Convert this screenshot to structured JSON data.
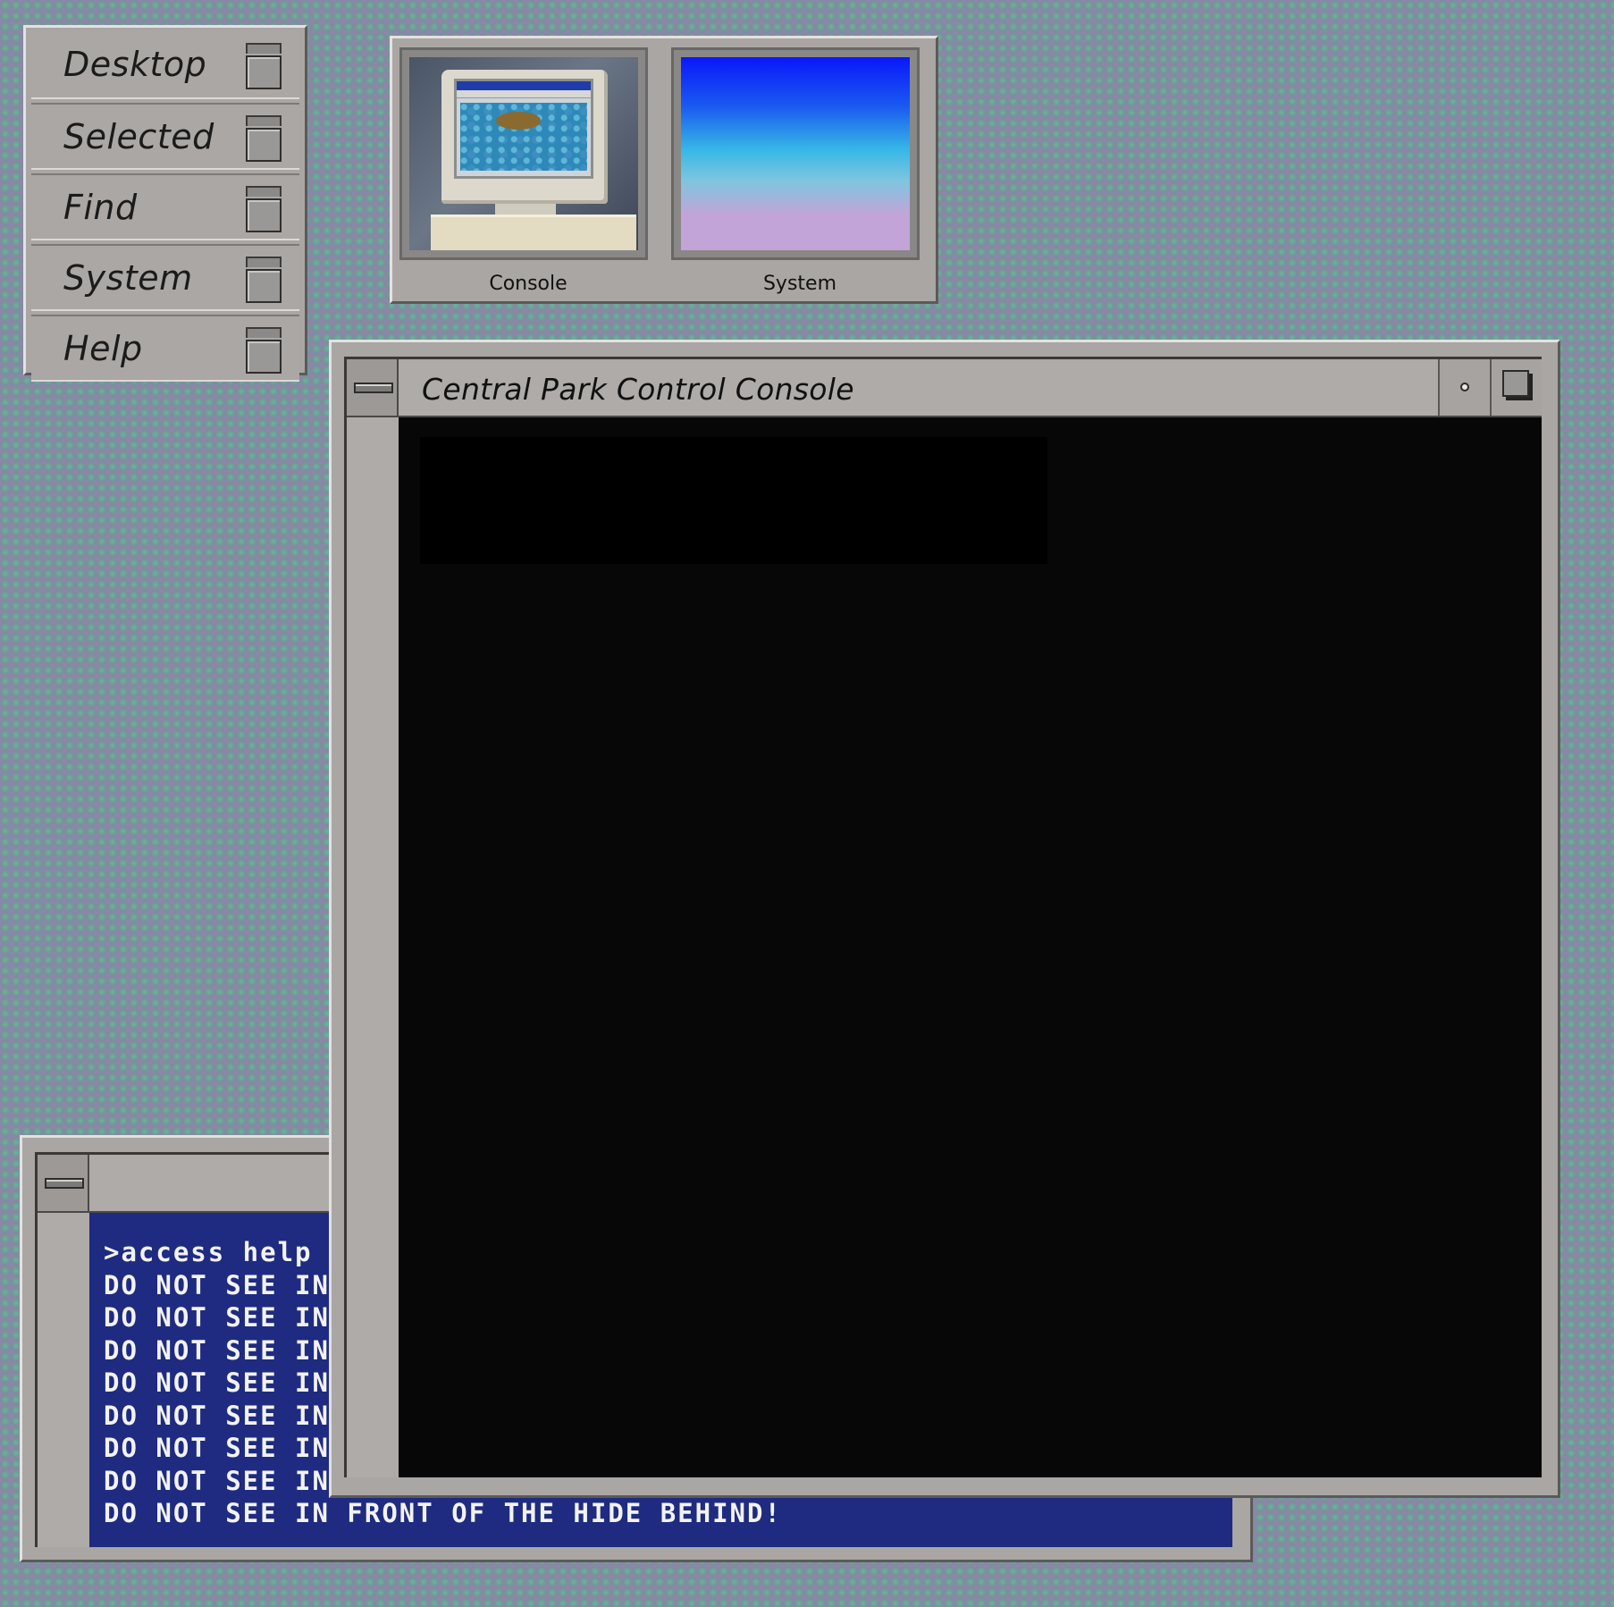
{
  "menu": {
    "items": [
      {
        "label": "Desktop"
      },
      {
        "label": "Selected"
      },
      {
        "label": "Find"
      },
      {
        "label": "System"
      },
      {
        "label": "Help"
      }
    ]
  },
  "thumbnails": [
    {
      "label": "Console"
    },
    {
      "label": "System"
    }
  ],
  "console_window": {
    "title": "Central Park Control Console",
    "input_value": ""
  },
  "help_window": {
    "lines": [
      ">access help",
      "DO NOT SEE IN FRONT OF THE HIDE BEHIND!",
      "DO NOT SEE IN FRONT OF THE HIDE BEHIND!",
      "DO NOT SEE IN FRONT OF THE HIDE BEHIND!",
      "DO NOT SEE IN FRONT OF THE HIDE BEHIND!",
      "DO NOT SEE IN FRONT OF THE HIDE BEHIND!",
      "DO NOT SEE IN FRONT OF THE HIDE BEHIND!",
      "DO NOT SEE IN FRONT OF THE HIDE BEHIND!",
      "DO NOT SEE IN FRONT OF THE HIDE BEHIND!"
    ]
  }
}
